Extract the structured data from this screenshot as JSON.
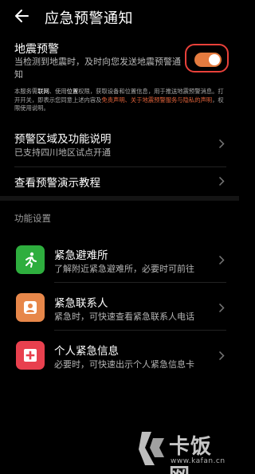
{
  "header": {
    "title": "应急预警通知"
  },
  "alert": {
    "title": "地震预警",
    "desc": "当检测到地震时，及时向您发送地震预警通知",
    "enabled": true,
    "accent": "#e47b3f"
  },
  "notice": {
    "p1": "本服务需",
    "b1": "联网",
    "p2": "、使用",
    "b2": "位置",
    "p3": "权限，获取设备和位置信息，用于推送地震预警消息。打开开关，即表示您同意上述内容及",
    "o1": "免责声明、关于地震预警服务与隐私的声明",
    "p4": "，权限使用说明。"
  },
  "rows": [
    {
      "title": "预警区域及功能说明",
      "sub": "已支持四川地区试点开通"
    },
    {
      "title": "查看预警演示教程",
      "sub": ""
    }
  ],
  "section_label": "功能设置",
  "features": [
    {
      "title": "紧急避难所",
      "sub": "了解附近紧急避难所，必要时可前往",
      "icon": "running-person-icon",
      "color": "#2eae3e"
    },
    {
      "title": "紧急联系人",
      "sub": "紧急时，可快速查看紧急联系人电话",
      "icon": "contact-person-icon",
      "color": "#e7874a"
    },
    {
      "title": "个人紧急信息",
      "sub": "必要时，可快速出示个人紧急信息卡",
      "icon": "medical-cross-icon",
      "color": "#e8404e"
    }
  ],
  "watermark": {
    "cn": "卡饭网",
    "url": "www.kafan.cn"
  }
}
